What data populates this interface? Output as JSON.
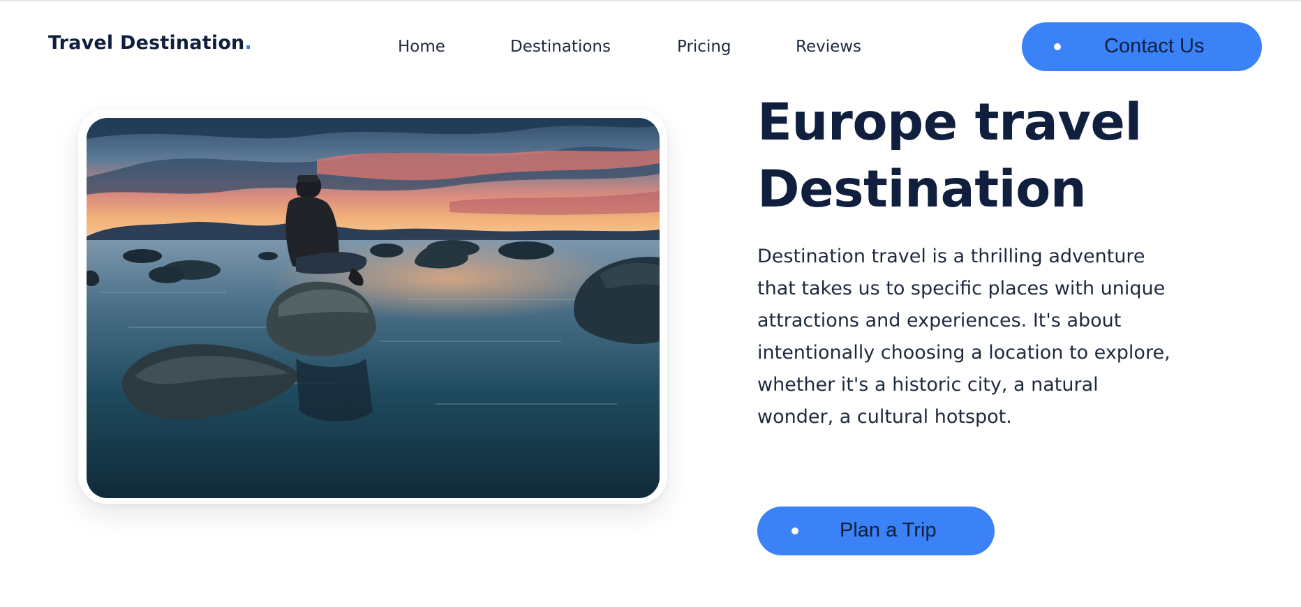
{
  "nav": {
    "logo_text": "Travel Destination",
    "logo_dot": ".",
    "links": [
      "Home",
      "Destinations",
      "Pricing",
      "Reviews"
    ],
    "cta_label": "Contact Us"
  },
  "hero": {
    "heading": "Europe travel Destination",
    "description": "Destination travel is a thrilling adventure that takes us to specific places with unique attractions and experiences. It's about intentionally choosing a location to explore, whether it's a historic city, a natural wonder, a cultural hotspot.",
    "cta_label": "Plan a Trip"
  },
  "colors": {
    "accent": "#3b82f6",
    "text_dark": "#0f1f3d"
  }
}
